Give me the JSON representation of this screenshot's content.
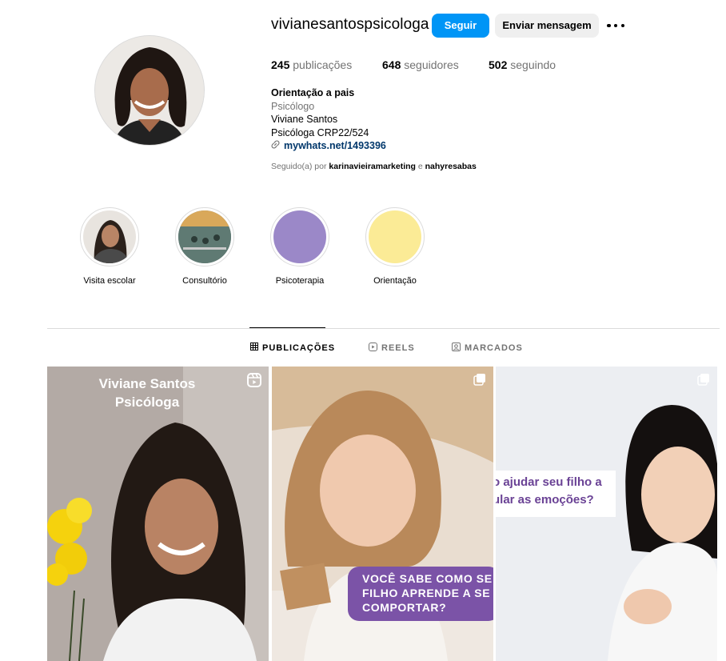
{
  "profile": {
    "username": "vivianesantospsicologa",
    "follow_label": "Seguir",
    "message_label": "Enviar mensagem",
    "stats": [
      {
        "count": "245",
        "label": "publicações"
      },
      {
        "count": "648",
        "label": "seguidores"
      },
      {
        "count": "502",
        "label": "seguindo"
      }
    ],
    "bio": {
      "name": "Orientação a pais",
      "category": "Psicólogo",
      "line1": "Viviane Santos",
      "line2": "Psicóloga CRP22/524",
      "link": "mywhats.net/1493396"
    },
    "followed_by": {
      "prefix": "Seguido(a) por",
      "user1": "karinavieiramarketing",
      "conj": "e",
      "user2": "nahyresabas"
    }
  },
  "highlights": [
    {
      "label": "Visita escolar",
      "icon": "person-photo"
    },
    {
      "label": "Consultório",
      "icon": "room-photo"
    },
    {
      "label": "Psicoterapia",
      "color": "#9b88c8"
    },
    {
      "label": "Orientação",
      "color": "#fbeb96"
    }
  ],
  "tabs": [
    {
      "label": "PUBLICAÇÕES",
      "icon": "grid-icon",
      "active": true
    },
    {
      "label": "REELS",
      "icon": "reels-icon",
      "active": false
    },
    {
      "label": "MARCADOS",
      "icon": "tagged-icon",
      "active": false
    }
  ],
  "posts": [
    {
      "title_line1": "Viviane Santos",
      "title_line2": "Psicóloga",
      "icon": "reels-icon"
    },
    {
      "text_line1": "VOCÊ SABE COMO SE",
      "text_line2": "FILHO APRENDE A SE",
      "text_line3": "COMPORTAR?",
      "icon": "carousel-icon"
    },
    {
      "text_line1": "o ajudar seu filho a",
      "text_line2": "ular as emoções?",
      "icon": "carousel-icon"
    }
  ],
  "colors": {
    "accent": "#0095f6",
    "purple": "#7b53a7"
  }
}
